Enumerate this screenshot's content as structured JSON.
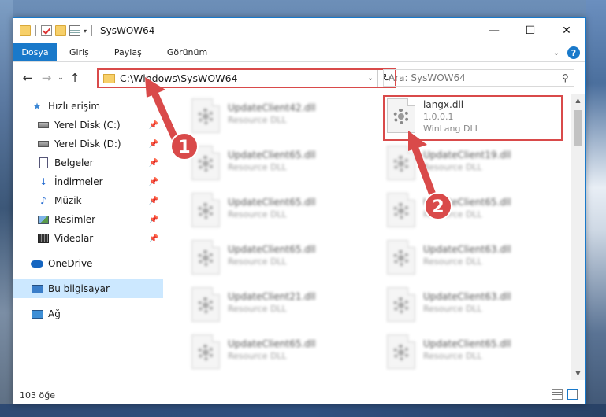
{
  "window": {
    "title": "SysWOW64",
    "controls": {
      "minimize": "—",
      "maximize": "☐",
      "close": "✕"
    }
  },
  "ribbon": {
    "file_tab": "Dosya",
    "tabs": [
      "Giriş",
      "Paylaş",
      "Görünüm"
    ],
    "help": "?"
  },
  "address": {
    "path": "C:\\Windows\\SysWOW64",
    "search_placeholder": "Ara: SysWOW64"
  },
  "sidebar": {
    "quick_access": "Hızlı erişim",
    "items": [
      {
        "label": "Yerel Disk (C:)",
        "icon": "drive-icon",
        "pinned": true
      },
      {
        "label": "Yerel Disk (D:)",
        "icon": "drive-icon",
        "pinned": true
      },
      {
        "label": "Belgeler",
        "icon": "documents-icon",
        "pinned": true
      },
      {
        "label": "İndirmeler",
        "icon": "download-icon",
        "pinned": true
      },
      {
        "label": "Müzik",
        "icon": "music-icon",
        "pinned": true
      },
      {
        "label": "Resimler",
        "icon": "pictures-icon",
        "pinned": true
      },
      {
        "label": "Videolar",
        "icon": "videos-icon",
        "pinned": true
      }
    ],
    "onedrive": "OneDrive",
    "this_pc": "Bu bilgisayar",
    "network": "Ağ"
  },
  "files": {
    "left": [
      {
        "name": "UpdateClient42.dll",
        "type": "Resource DLL"
      },
      {
        "name": "UpdateClient65.dll",
        "type": "Resource DLL"
      },
      {
        "name": "UpdateClient65.dll",
        "type": "Resource DLL"
      },
      {
        "name": "UpdateClient65.dll",
        "type": "Resource DLL"
      },
      {
        "name": "UpdateClient21.dll",
        "type": "Resource DLL"
      },
      {
        "name": "UpdateClient65.dll",
        "type": "Resource DLL"
      }
    ],
    "highlighted": {
      "name": "langx.dll",
      "version": "1.0.0.1",
      "type": "WinLang DLL"
    },
    "right": [
      {
        "name": "UpdateClient19.dll",
        "type": "Resource DLL"
      },
      {
        "name": "UpdateClient65.dll",
        "type": "Resource DLL"
      },
      {
        "name": "UpdateClient63.dll",
        "type": "Resource DLL"
      },
      {
        "name": "UpdateClient63.dll",
        "type": "Resource DLL"
      },
      {
        "name": "UpdateClient65.dll",
        "type": "Resource DLL"
      }
    ]
  },
  "status": {
    "item_count": "103 öğe"
  },
  "annotations": {
    "badge1": "1",
    "badge2": "2",
    "color": "#d94a4a"
  }
}
